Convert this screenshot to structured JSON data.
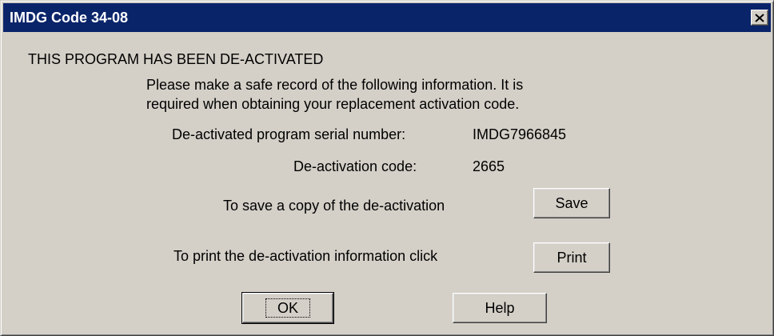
{
  "window": {
    "title": "IMDG Code 34-08",
    "close_icon": "close-icon"
  },
  "dialog": {
    "heading": "THIS PROGRAM HAS BEEN DE-ACTIVATED",
    "instruction_line1": "Please make a safe record of the following information. It is",
    "instruction_line2": "required when obtaining your replacement activation code.",
    "serial_label": "De-activated program serial number:",
    "serial_value": "IMDG7966845",
    "code_label": "De-activation code:",
    "code_value": "2665",
    "save_prompt": "To save a copy of the de-activation",
    "save_button": "Save",
    "print_prompt": "To print the de-activation information click",
    "print_button": "Print",
    "ok_button": "OK",
    "help_button": "Help"
  },
  "colors": {
    "titlebar": "#0a246a",
    "face": "#d4d0c8"
  }
}
